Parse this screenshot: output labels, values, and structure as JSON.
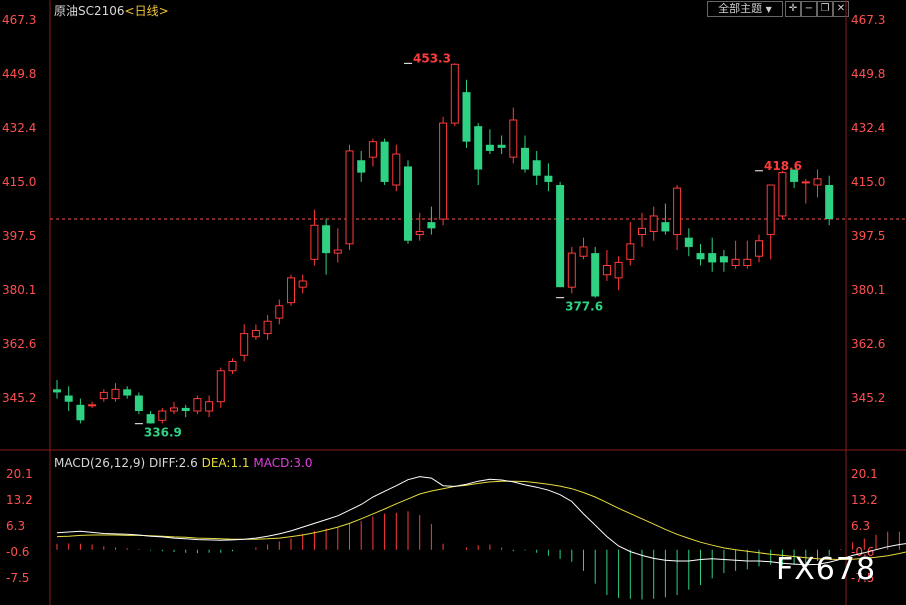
{
  "header": {
    "instrument": "原油SC2106",
    "period": "<日线>"
  },
  "toolbar": {
    "theme_label": "全部主题",
    "theme_icon": "dropdown-icon",
    "buttons": [
      "crosshair-icon",
      "minimize-icon",
      "restore-icon",
      "close-icon"
    ]
  },
  "macd_header": {
    "name": "MACD(26,12,9)",
    "diff": "DIFF:2.6",
    "dea": "DEA:1.1",
    "macd": "MACD:3.0"
  },
  "watermark": "FX678",
  "colors": {
    "up": "#ff3b3b",
    "down": "#2fd183",
    "diff_line": "#ffffff",
    "dea_line": "#e6db3c",
    "axis_label": "#ff5050",
    "dashed_ref": "#ff5050"
  },
  "chart_data": [
    {
      "type": "candlestick",
      "y_ticks": [
        "467.3",
        "449.8",
        "432.4",
        "415.0",
        "397.5",
        "380.1",
        "362.6",
        "345.2"
      ],
      "ylim": [
        332.0,
        467.3
      ],
      "reference_line": 403.0,
      "annotations": [
        {
          "text": "453.3",
          "index": 30,
          "value": 453.3,
          "kind": "high"
        },
        {
          "text": "336.9",
          "index": 7,
          "value": 336.9,
          "kind": "low"
        },
        {
          "text": "377.6",
          "index": 43,
          "value": 377.6,
          "kind": "low"
        },
        {
          "text": "418.6",
          "index": 60,
          "value": 418.6,
          "kind": "high"
        }
      ],
      "candles": [
        [
          348,
          347,
          351,
          345
        ],
        [
          346,
          344,
          349,
          341
        ],
        [
          343,
          338,
          345,
          337
        ],
        [
          343,
          343,
          344,
          342
        ],
        [
          345,
          347,
          348,
          344
        ],
        [
          345,
          348,
          350,
          344
        ],
        [
          348,
          346,
          349,
          345
        ],
        [
          346,
          341,
          347,
          340
        ],
        [
          340,
          337,
          341,
          336.9
        ],
        [
          338,
          341,
          342,
          337
        ],
        [
          341,
          342,
          344,
          340
        ],
        [
          342,
          341,
          343,
          339
        ],
        [
          341,
          345,
          346,
          340
        ],
        [
          341,
          344,
          346,
          339
        ],
        [
          344,
          354,
          355,
          342
        ],
        [
          354,
          357,
          358,
          353
        ],
        [
          359,
          366,
          369,
          357
        ],
        [
          365,
          367,
          369,
          364
        ],
        [
          366,
          370,
          372,
          364
        ],
        [
          371,
          375,
          377,
          369
        ],
        [
          376,
          384,
          385,
          375
        ],
        [
          381,
          383,
          385,
          379
        ],
        [
          390,
          401,
          406,
          388
        ],
        [
          401,
          392,
          403,
          385
        ],
        [
          392,
          393,
          400,
          389
        ],
        [
          395,
          425,
          427,
          393
        ],
        [
          422,
          418,
          425,
          415
        ],
        [
          423,
          428,
          429,
          420
        ],
        [
          428,
          415,
          429,
          414
        ],
        [
          414,
          424,
          427,
          412
        ],
        [
          420,
          396,
          422,
          395
        ],
        [
          398,
          399,
          405,
          396
        ],
        [
          402,
          400,
          407,
          398
        ],
        [
          403,
          434,
          436,
          401
        ],
        [
          434,
          453,
          453.3,
          433
        ],
        [
          444,
          428,
          448,
          426
        ],
        [
          433,
          419,
          434,
          414
        ],
        [
          427,
          425,
          432,
          424
        ],
        [
          427,
          426,
          430,
          424
        ],
        [
          423,
          435,
          439,
          421
        ],
        [
          426,
          419,
          430,
          418
        ],
        [
          422,
          417,
          425,
          414
        ],
        [
          417,
          415,
          421,
          412
        ],
        [
          414,
          381,
          415,
          381
        ],
        [
          381,
          392,
          394,
          379
        ],
        [
          391,
          394,
          397,
          390
        ],
        [
          392,
          378,
          394,
          377.6
        ],
        [
          385,
          388,
          393,
          383
        ],
        [
          384,
          389,
          391,
          380
        ],
        [
          390,
          395,
          402,
          388
        ],
        [
          398,
          400,
          405,
          394
        ],
        [
          399,
          404,
          407,
          396
        ],
        [
          402,
          399,
          408,
          398
        ],
        [
          398,
          413,
          414,
          393
        ],
        [
          397,
          394,
          400,
          391
        ],
        [
          392,
          390,
          395,
          388
        ],
        [
          392,
          389,
          397,
          386
        ],
        [
          391,
          389,
          393,
          386
        ],
        [
          388,
          390,
          396,
          387
        ],
        [
          388,
          390,
          396,
          387
        ],
        [
          391,
          396,
          398,
          389
        ],
        [
          398,
          414,
          414,
          390
        ],
        [
          404,
          418,
          418.6,
          403
        ],
        [
          419,
          415,
          419,
          413
        ],
        [
          415,
          415,
          416,
          408
        ],
        [
          414,
          416,
          419,
          410
        ],
        [
          414,
          403,
          417,
          401
        ]
      ]
    },
    {
      "type": "macd",
      "y_ticks": [
        "20.1",
        "13.2",
        "6.3",
        "-0.6",
        "-7.5"
      ],
      "ylim": [
        -14.4,
        20.1
      ],
      "diff": [
        4.5,
        4.7,
        4.9,
        4.6,
        4.3,
        4.2,
        4.1,
        3.9,
        3.6,
        3.4,
        3.1,
        2.9,
        2.7,
        2.6,
        2.5,
        2.6,
        2.8,
        3.1,
        3.6,
        4.2,
        5.0,
        6.0,
        7.0,
        8.0,
        9.0,
        10.5,
        12.0,
        14.0,
        15.5,
        17.0,
        18.6,
        19.4,
        19.0,
        17.0,
        16.8,
        17.4,
        18.2,
        18.7,
        18.5,
        18.0,
        17.2,
        16.6,
        15.8,
        14.6,
        12.8,
        9.5,
        6.5,
        3.5,
        1.0,
        -0.5,
        -1.5,
        -2.3,
        -2.8,
        -3.0,
        -3.0,
        -2.6,
        -2.4,
        -2.6,
        -2.8,
        -3.0,
        -3.0,
        -3.2,
        -3.6,
        -3.8,
        -4.0,
        -3.9,
        -3.3,
        -2.5,
        -1.5,
        -0.8,
        0.0,
        0.8,
        1.4,
        1.8,
        2.2,
        2.6
      ],
      "dea": [
        3.5,
        3.6,
        3.8,
        3.9,
        3.9,
        3.9,
        3.8,
        3.8,
        3.7,
        3.6,
        3.4,
        3.3,
        3.1,
        3.0,
        2.9,
        2.8,
        2.8,
        2.8,
        2.9,
        3.1,
        3.5,
        3.9,
        4.5,
        5.2,
        6.0,
        7.0,
        8.2,
        9.5,
        10.8,
        12.2,
        13.5,
        14.8,
        15.6,
        16.2,
        16.8,
        17.1,
        17.6,
        18.0,
        18.2,
        18.2,
        18.1,
        17.8,
        17.4,
        16.9,
        16.2,
        15.2,
        14.0,
        12.5,
        11.0,
        9.6,
        8.2,
        6.8,
        5.4,
        4.1,
        3.0,
        2.0,
        1.2,
        0.5,
        0.0,
        -0.4,
        -0.8,
        -1.2,
        -1.5,
        -1.8,
        -2.1,
        -2.4,
        -2.5,
        -2.6,
        -2.5,
        -2.3,
        -2.0,
        -1.6,
        -1.0,
        -0.3,
        0.4,
        1.1
      ],
      "hist": [
        1.6,
        1.7,
        1.6,
        1.4,
        0.9,
        0.6,
        0.4,
        0.2,
        -0.2,
        -0.4,
        -0.6,
        -0.8,
        -0.9,
        -0.8,
        -0.8,
        -0.4,
        0.0,
        0.6,
        1.4,
        2.2,
        3.0,
        4.2,
        5.0,
        5.6,
        6.0,
        7.0,
        7.6,
        8.8,
        9.6,
        9.8,
        10.2,
        9.2,
        6.8,
        1.6,
        0.0,
        0.6,
        1.2,
        1.4,
        0.6,
        -0.4,
        -0.2,
        -0.8,
        -1.6,
        -2.4,
        -3.2,
        -5.6,
        -9.0,
        -12.0,
        -12.8,
        -13.0,
        -13.2,
        -13.0,
        -12.6,
        -12.0,
        -10.6,
        -9.4,
        -7.6,
        -6.2,
        -5.6,
        -5.2,
        -4.4,
        -4.0,
        -4.2,
        -4.0,
        -3.8,
        -3.0,
        -1.6,
        0.2,
        2.0,
        3.0,
        4.0,
        4.8,
        4.8,
        4.2,
        3.6,
        3.0
      ]
    }
  ]
}
